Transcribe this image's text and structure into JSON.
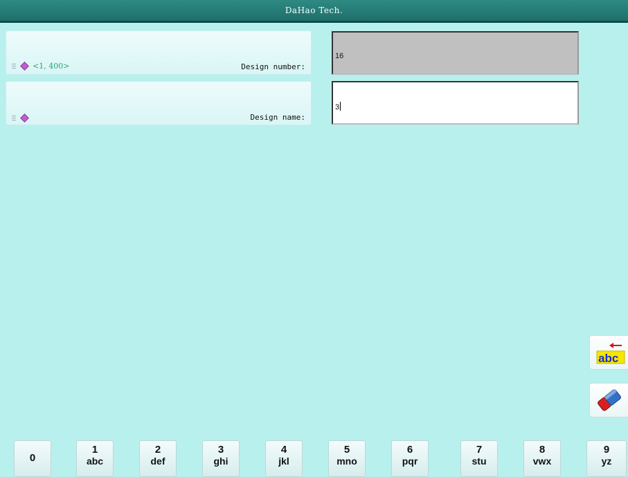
{
  "app": {
    "title": "DaHao Tech."
  },
  "form": {
    "design_number": {
      "range_hint": "<1, 400>",
      "label": "Design number:",
      "value": "16"
    },
    "design_name": {
      "label": "Design name:",
      "value": "3"
    }
  },
  "side_tools": [
    {
      "name": "backspace-abc-icon",
      "text": "abc"
    },
    {
      "name": "eraser-icon"
    }
  ],
  "keypad": [
    {
      "digit": "0",
      "letters": ""
    },
    {
      "digit": "1",
      "letters": "abc"
    },
    {
      "digit": "2",
      "letters": "def"
    },
    {
      "digit": "3",
      "letters": "ghi"
    },
    {
      "digit": "4",
      "letters": "jkl"
    },
    {
      "digit": "5",
      "letters": "mno"
    },
    {
      "digit": "6",
      "letters": "pqr"
    },
    {
      "digit": "7",
      "letters": "stu"
    },
    {
      "digit": "8",
      "letters": "vwx"
    },
    {
      "digit": "9",
      "letters": "yz"
    }
  ]
}
